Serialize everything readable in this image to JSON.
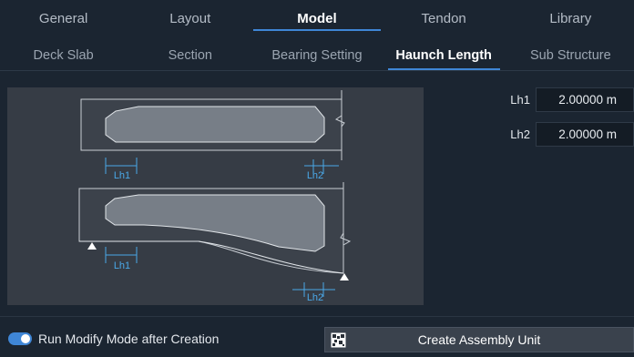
{
  "top_tabs": [
    {
      "label": "General"
    },
    {
      "label": "Layout"
    },
    {
      "label": "Model",
      "active": true
    },
    {
      "label": "Tendon"
    },
    {
      "label": "Library"
    }
  ],
  "sub_tabs": [
    {
      "label": "Deck Slab"
    },
    {
      "label": "Section"
    },
    {
      "label": "Bearing Setting"
    },
    {
      "label": "Haunch Length",
      "active": true
    },
    {
      "label": "Sub Structure"
    }
  ],
  "diagram": {
    "top_lh1": "Lh1",
    "top_lh2": "Lh2",
    "bottom_lh1": "Lh1",
    "bottom_lh2": "Lh2"
  },
  "params": {
    "lh1": {
      "label": "Lh1",
      "value": "2.00000 m"
    },
    "lh2": {
      "label": "Lh2",
      "value": "2.00000 m"
    }
  },
  "bottom": {
    "modify_toggle_label": "Run Modify Mode after Creation",
    "modify_toggle_on": true,
    "create_button_label": "Create Assembly Unit"
  },
  "colors": {
    "accent": "#3f86d6",
    "dimension": "#4aa8e8"
  }
}
